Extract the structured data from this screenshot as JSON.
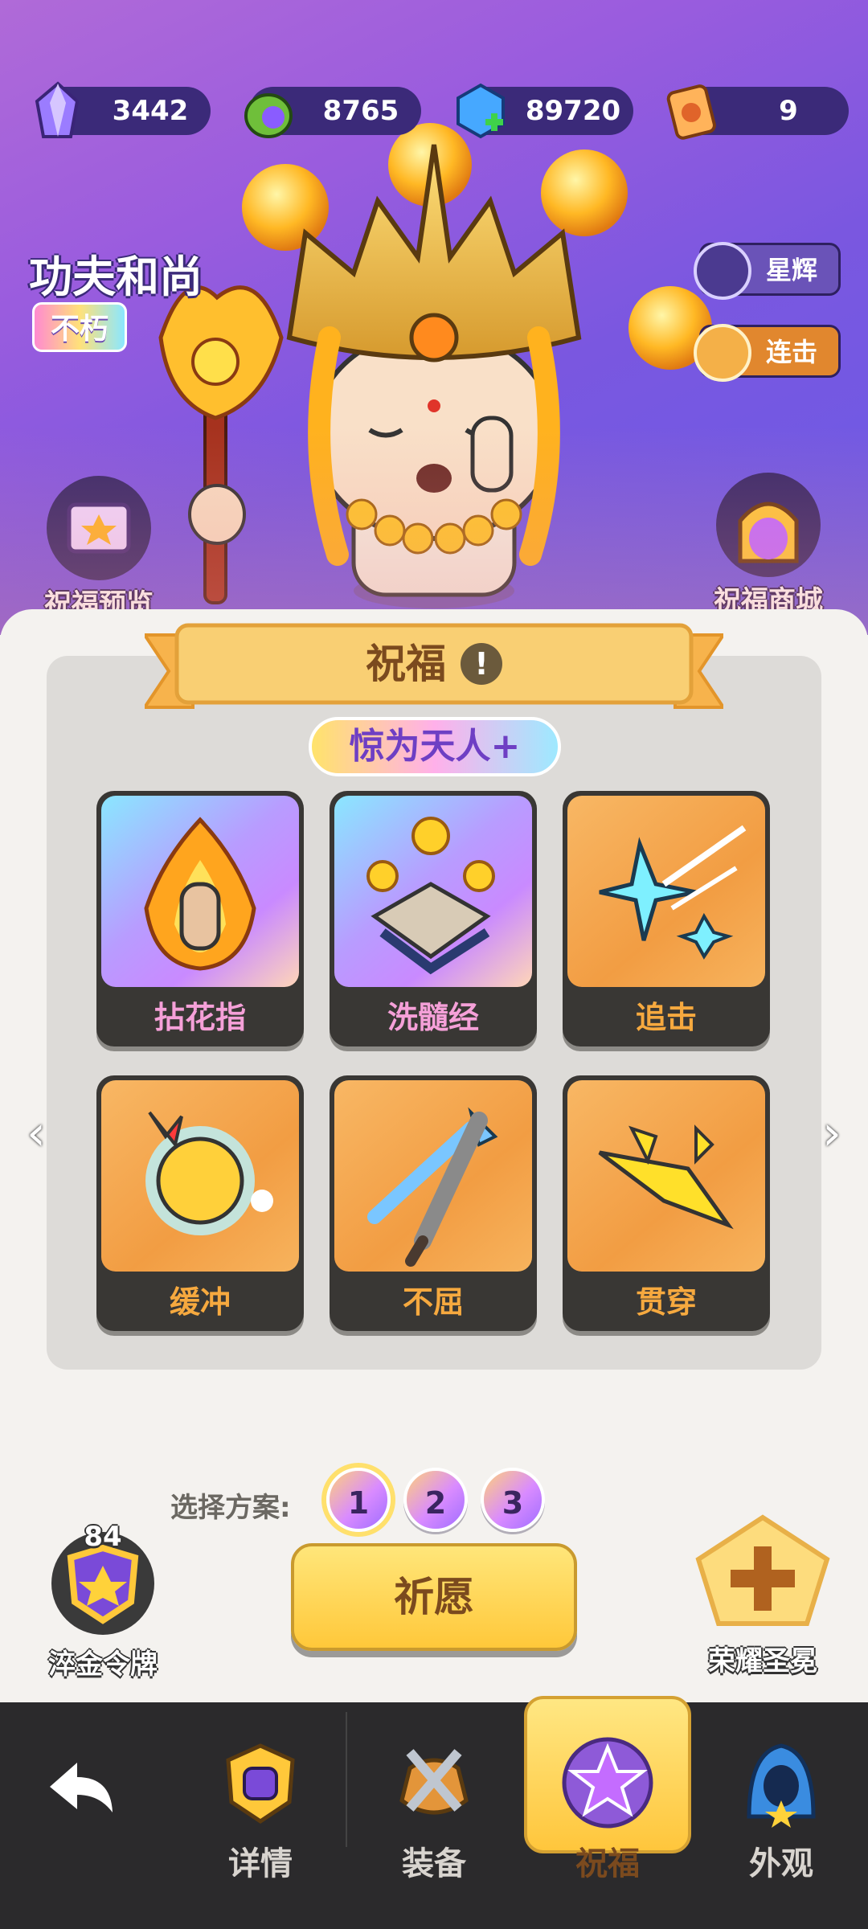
{
  "resources": [
    {
      "name": "crystal",
      "value": "3442",
      "icon": "crystal-icon"
    },
    {
      "name": "potion",
      "value": "8765",
      "icon": "potion-icon"
    },
    {
      "name": "gem",
      "value": "89720",
      "icon": "gem-plus-icon"
    },
    {
      "name": "scroll",
      "value": "9",
      "icon": "scroll-icon"
    }
  ],
  "hero": {
    "name": "功夫和尚",
    "rank": "不朽",
    "side_buttons": [
      {
        "label": "星辉",
        "icon": "star-glow-icon"
      },
      {
        "label": "连击",
        "icon": "combo-moon-icon"
      }
    ],
    "blessing_preview": "祝福预览",
    "blessing_shop": "祝福商城"
  },
  "panel": {
    "title": "祝福",
    "info_icon": "!",
    "tier": "惊为天人+",
    "cards": [
      {
        "label": "拈花指",
        "style": "purple",
        "icon": "flower-finger-icon"
      },
      {
        "label": "洗髓经",
        "style": "purple",
        "icon": "scripture-icon"
      },
      {
        "label": "追击",
        "style": "orange",
        "icon": "shuriken-icon"
      },
      {
        "label": "缓冲",
        "style": "orange",
        "icon": "shield-face-icon"
      },
      {
        "label": "不屈",
        "style": "orange",
        "icon": "crossed-swords-icon"
      },
      {
        "label": "贯穿",
        "style": "orange",
        "icon": "pierce-arrow-icon"
      }
    ],
    "prev_arrow": "‹",
    "next_arrow": "›"
  },
  "plan": {
    "label": "选择方案:",
    "options": [
      "1",
      "2",
      "3"
    ],
    "active": "1"
  },
  "actions": {
    "wish": "祈愿",
    "token_count": "84",
    "token_label": "淬金令牌",
    "crown_label": "荣耀圣冕"
  },
  "nav": {
    "back_icon": "back-arrow-icon",
    "items": [
      {
        "label": "详情",
        "icon": "helmet-icon"
      },
      {
        "label": "装备",
        "icon": "equipment-icon"
      },
      {
        "label": "祝福",
        "icon": "blessing-star-icon",
        "active": true
      },
      {
        "label": "外观",
        "icon": "hood-icon"
      }
    ]
  },
  "colors": {
    "hero_bg": "#9a5cde",
    "resource_bar": "#3b2a79",
    "card_orange": "#f29d43",
    "card_purple": "#b89cff",
    "wish_button": "#ffc83a",
    "nav_bg": "#2b2a2c"
  }
}
